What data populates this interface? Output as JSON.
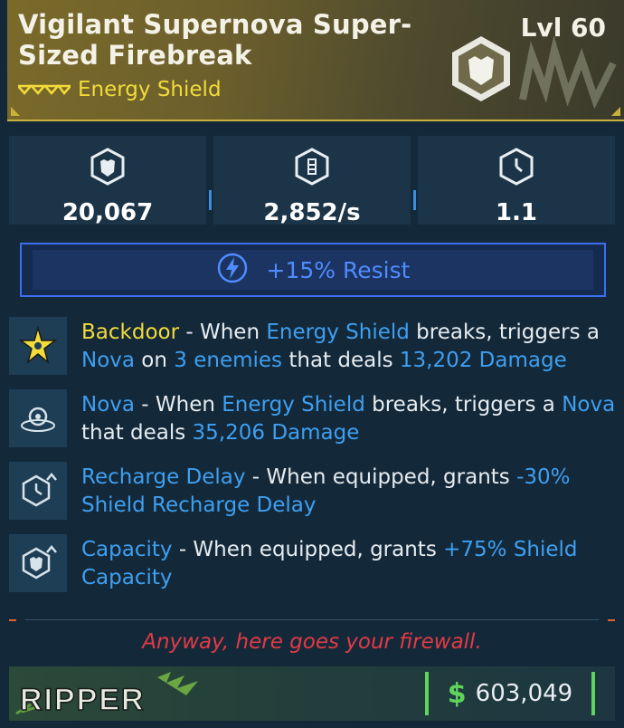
{
  "item": {
    "title": "Vigilant Supernova Super-Sized Firebreak",
    "level": "Lvl 60",
    "type": "Energy Shield",
    "rarity_color": "#f2dc3a"
  },
  "stats": [
    {
      "icon": "shield-capacity-icon",
      "value": "20,067"
    },
    {
      "icon": "recharge-rate-icon",
      "value": "2,852/s"
    },
    {
      "icon": "recharge-delay-icon",
      "value": "1.1"
    }
  ],
  "resist": {
    "icon": "shock-element-icon",
    "label": "+15% Resist",
    "color": "#4f8cff"
  },
  "perks": [
    {
      "icon": "backdoor-star-icon",
      "name": "Backdoor",
      "t1": " - When ",
      "k1": "Energy Shield",
      "t2": " breaks, triggers a ",
      "k2": "Nova",
      "t3": " on ",
      "k3": "3 enemies",
      "t4": " that deals ",
      "k4": "13,202 Damage"
    },
    {
      "icon": "nova-blast-icon",
      "name": "Nova",
      "t1": " - When ",
      "k1": "Energy Shield",
      "t2": " breaks, triggers a ",
      "k2": "Nova",
      "t3": " that deals ",
      "k3": "35,206 Damage"
    },
    {
      "icon": "recharge-delay-up-icon",
      "name": "Recharge Delay",
      "t1": " - When equipped, grants ",
      "k1": "-30%",
      "k2": "Shield Recharge Delay"
    },
    {
      "icon": "capacity-up-icon",
      "name": "Capacity",
      "t1": " - When equipped, grants ",
      "k1": "+75% Shield",
      "k2": "Capacity"
    }
  ],
  "flavor_text": "Anyway, here goes your firewall.",
  "footer": {
    "brand": "RIPPER",
    "currency_symbol": "$",
    "price": "603,049"
  }
}
